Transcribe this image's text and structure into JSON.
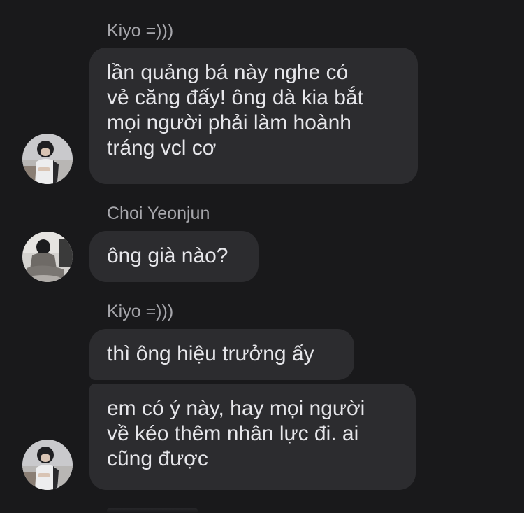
{
  "messages": [
    {
      "sender": "Kiyo =)))",
      "lines": [
        "lần quảng bá này nghe có",
        "vẻ căng đấy! ông dà kia bắt",
        "mọi người phải làm hoành",
        "tráng vcl cơ"
      ]
    },
    {
      "sender": "Choi Yeonjun",
      "lines": [
        "ông già nào?"
      ]
    },
    {
      "sender": "Kiyo =)))",
      "lines": [
        "thì ông hiệu trưởng ấy"
      ]
    },
    {
      "lines": [
        "em có ý này, hay mọi người",
        "về kéo thêm nhân lực đi. ai",
        "cũng được"
      ]
    }
  ],
  "colors": {
    "background": "#19191b",
    "bubble": "#2c2c2f",
    "bubble_text": "#e6e6ea",
    "sender_text": "#a6a6ab"
  },
  "icons": {
    "kiyo_avatar": "photo-person-sitting-dark-hair",
    "yeonjun_avatar": "photo-person-sitting-hooded"
  }
}
